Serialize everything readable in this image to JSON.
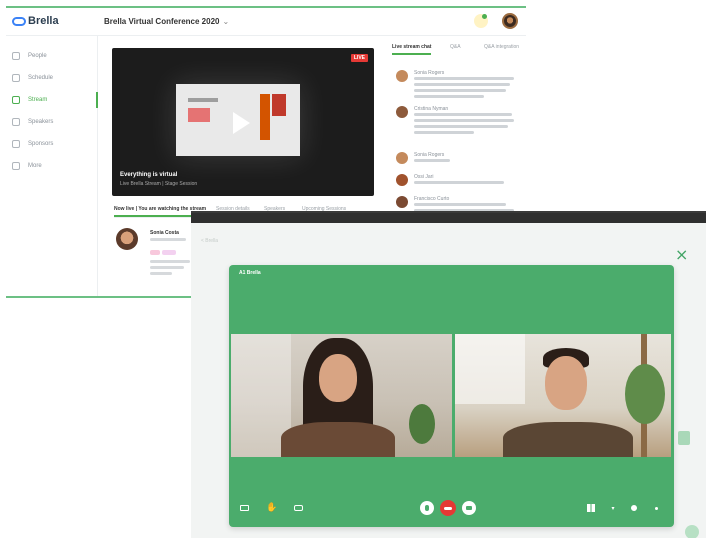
{
  "back_window": {
    "logo": "Brella",
    "event_title": "Brella Virtual Conference 2020",
    "nav": [
      {
        "label": "People",
        "icon": "people-icon"
      },
      {
        "label": "Schedule",
        "icon": "calendar-icon"
      },
      {
        "label": "Stream",
        "icon": "stream-icon"
      },
      {
        "label": "Speakers",
        "icon": "speaker-icon"
      },
      {
        "label": "Sponsors",
        "icon": "sponsor-icon"
      },
      {
        "label": "More",
        "icon": "more-icon"
      }
    ],
    "stream": {
      "live_badge": "LIVE",
      "caption": "Everything is virtual",
      "subcaption": "Live Brella Stream | Stage Session"
    },
    "stream_tabs": [
      "Now live | You are watching the stream",
      "Session details",
      "Speakers",
      "Upcoming Sessions"
    ],
    "profile": {
      "name": "Sonia Costa"
    },
    "chat_tabs": [
      "Live stream chat",
      "Q&A",
      "Q&A integration"
    ],
    "chat_messages": [
      {
        "name": "Sonia Rogers"
      },
      {
        "name": "Cristina Nyman"
      },
      {
        "name": "Sonia Rogers"
      },
      {
        "name": "Ossi Jari"
      },
      {
        "name": "Francisco Curto"
      }
    ]
  },
  "call_window": {
    "ghost_text": "< Brella",
    "room_name": "A1 Brella",
    "close_label": "×"
  },
  "colors": {
    "accent": "#4bac6c",
    "hangup": "#e53935",
    "brand": "#3b82f6"
  }
}
